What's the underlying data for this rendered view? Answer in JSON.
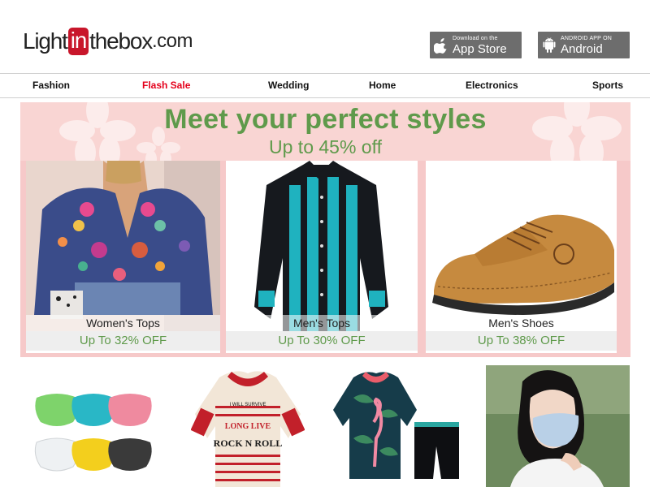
{
  "logo": {
    "part1": "Light",
    "part2": "in",
    "part3": "thebox",
    "part4": ".com"
  },
  "app_buttons": {
    "appstore_small": "Download on the",
    "appstore_big": "App Store",
    "android_small": "ANDROID APP ON",
    "android_big": "Android"
  },
  "nav": {
    "items": [
      "Fashion",
      "Flash Sale",
      "Wedding",
      "Home",
      "Electronics",
      "Sports"
    ],
    "highlight_color": "#e4001b"
  },
  "banner": {
    "headline": "Meet your perfect styles",
    "subline": "Up to 45% off",
    "accent": "#5f9a4b",
    "cards": [
      {
        "label": "Women's Tops",
        "offer": "Up To 32% OFF"
      },
      {
        "label": "Men's Tops",
        "offer": "Up To 30% OFF"
      },
      {
        "label": "Men's Shoes",
        "offer": "Up To 38% OFF"
      }
    ]
  },
  "jersey_text": {
    "line1": "I WILL SURVIVE",
    "line2": "LONG LIVE",
    "line3": "ROCK N ROLL"
  },
  "products": [
    "face-masks",
    "cycling-jersey-rock",
    "cycling-jersey-flamingo",
    "woman-wearing-mask"
  ]
}
